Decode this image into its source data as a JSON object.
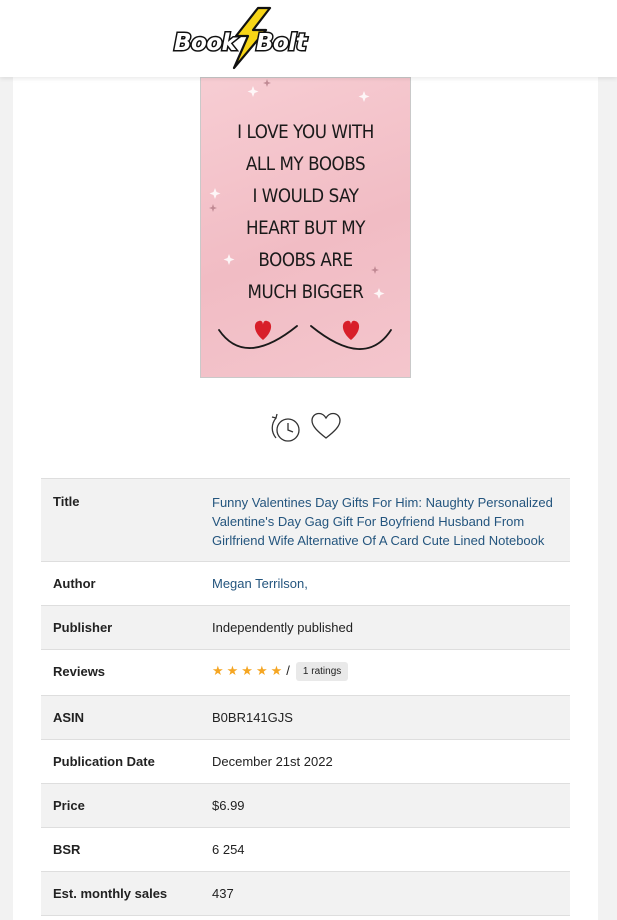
{
  "header": {
    "logo_text_left": "Book",
    "logo_text_right": "Bolt"
  },
  "book": {
    "cover_text": "I LOVE YOU WITH\nALL MY BOOBS\nI WOULD SAY\nHEART BUT MY\nBOOBS ARE\nMUCH BIGGER",
    "cover_colors": {
      "background": "#f4c6cd",
      "heart": "#d81f2a"
    }
  },
  "actions": {
    "history_icon": "history-clock-icon",
    "favorite_icon": "heart-outline-icon"
  },
  "details": {
    "title": {
      "label": "Title",
      "value": "Funny Valentines Day Gifts For Him: Naughty Personalized Valentine's Day Gag Gift For Boyfriend Husband From Girlfriend Wife Alternative Of A Card Cute Lined Notebook"
    },
    "author": {
      "label": "Author",
      "value": "Megan Terrilson,"
    },
    "publisher": {
      "label": "Publisher",
      "value": "Independently published"
    },
    "reviews": {
      "label": "Reviews",
      "stars": "★★★★★",
      "star_rating": 5,
      "separator": "/",
      "ratings_badge": "1 ratings"
    },
    "asin": {
      "label": "ASIN",
      "value": "B0BR141GJS"
    },
    "publication_date": {
      "label": "Publication Date",
      "value": "December 21st 2022"
    },
    "price": {
      "label": "Price",
      "value": "$6.99"
    },
    "bsr": {
      "label": "BSR",
      "value": "6 254"
    },
    "monthly_sales": {
      "label": "Est. monthly sales",
      "value": "437"
    }
  },
  "colors": {
    "link": "#24557e",
    "star": "#f5a623",
    "logo_bolt": "#f7d517"
  }
}
